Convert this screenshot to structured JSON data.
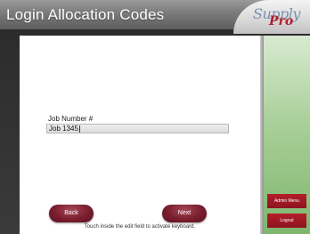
{
  "header": {
    "title": "Login Allocation Codes",
    "logo_main": "Supply",
    "logo_sub": "Pro"
  },
  "form": {
    "job_label": "Job Number #",
    "job_value": "Job 1345"
  },
  "buttons": {
    "back": "Back",
    "next": "Next"
  },
  "hint": "Touch inside the edit field to activate keyboard.",
  "sidebar": {
    "admin_label": "Admin Menu",
    "logout_label": "Logout"
  },
  "colors": {
    "accent": "#8d1420",
    "sidebar_green": "#a8cf98"
  }
}
